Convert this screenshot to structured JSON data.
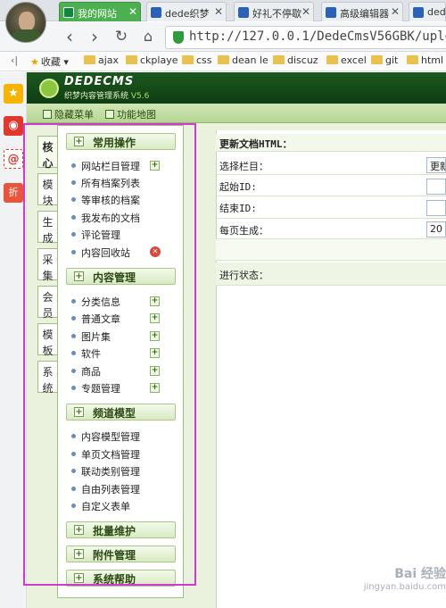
{
  "browser": {
    "tabs": [
      {
        "label": "我的网站",
        "active": true
      },
      {
        "label": "dede织梦"
      },
      {
        "label": "好礼不停歇"
      },
      {
        "label": "高级编辑器"
      },
      {
        "label": "ded"
      }
    ],
    "url": "http://127.0.0.1/DedeCmsV56GBK/uploads/d",
    "bookmarks": [
      "收藏",
      "ajax",
      "ckplaye",
      "css",
      "dean le",
      "discuz",
      "excel",
      "git",
      "html"
    ]
  },
  "app": {
    "logo_text": "DEDECMS",
    "subtitle": "织梦内容管理系统",
    "version": "V5.6",
    "toolbar": {
      "hide_menu": "隐藏菜单",
      "function_map": "功能地图"
    }
  },
  "side_tabs": [
    "核心",
    "模块",
    "生成",
    "采集",
    "会员",
    "模板",
    "系统"
  ],
  "menu": {
    "common_header": "常用操作",
    "common_items": [
      "网站栏目管理",
      "所有档案列表",
      "等审核的档案",
      "我发布的文档",
      "评论管理",
      "内容回收站"
    ],
    "content_header": "内容管理",
    "content_items": [
      "分类信息",
      "普通文章",
      "图片集",
      "软件",
      "商品",
      "专题管理"
    ],
    "channel_header": "频道模型",
    "channel_items": [
      "内容模型管理",
      "单页文档管理",
      "联动类别管理",
      "自由列表管理",
      "自定义表单"
    ],
    "batch_header": "批量维护",
    "attach_header": "附件管理",
    "help_header": "系统帮助"
  },
  "content": {
    "section_title": "更新文档HTML：",
    "label_column": "选择栏目：",
    "column_value": "更新",
    "label_start": "起始ID:",
    "label_end": "结束ID:",
    "label_per_page": "每页生成：",
    "per_page_value": "20",
    "status_label": "进行状态："
  },
  "watermark": {
    "brand": "Bai 经验",
    "domain": "jingyan.baidu.com"
  },
  "colors": {
    "header_green": "#1c5a1f",
    "active_tab": "#4caf50",
    "highlight": "#d03ad0"
  }
}
